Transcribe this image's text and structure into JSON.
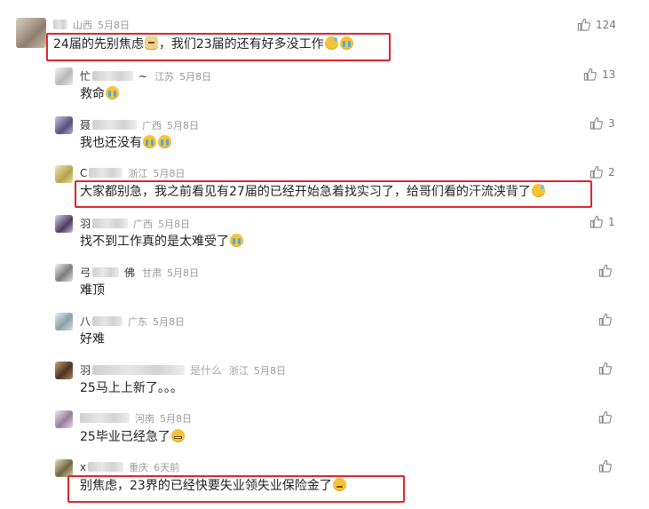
{
  "comments": [
    {
      "lead": "",
      "loc": "山西",
      "date": "5月8日",
      "text_before": "24届的先别焦虑",
      "text_mid": "，我们23届的还有好多没工作",
      "likes": "124"
    },
    {
      "lead": "忙",
      "lead2": "~",
      "loc": "江苏",
      "date": "5月8日",
      "text_before": "救命",
      "text_mid": "",
      "likes": "13"
    },
    {
      "lead": "聂",
      "loc": "广西",
      "date": "5月8日",
      "text_before": "我也还没有",
      "text_mid": "",
      "likes": "3"
    },
    {
      "lead": "C",
      "loc": "浙江",
      "date": "5月8日",
      "text_before": "大家都别急，我之前看见有27届的已经开始急着找实习了，给哥们看的汗流浃背了",
      "text_mid": "",
      "likes": "2"
    },
    {
      "lead": "羽",
      "loc": "广西",
      "date": "5月8日",
      "text_before": "找不到工作真的是太难受了",
      "text_mid": "",
      "likes": "1"
    },
    {
      "lead": "弓",
      "lead2": "佛",
      "loc": "甘肃",
      "date": "5月8日",
      "text_before": "难顶",
      "text_mid": "",
      "likes": ""
    },
    {
      "lead": "八",
      "loc": "广东",
      "date": "5月8日",
      "text_before": "好难",
      "text_mid": "",
      "likes": ""
    },
    {
      "lead": "羽",
      "lead2": "是什么",
      "loc": "浙江",
      "date": "5月8日",
      "text_before": "25马上上新了。。。",
      "text_mid": "",
      "likes": ""
    },
    {
      "lead": "",
      "loc": "河南",
      "date": "5月8日",
      "text_before": "25毕业已经急了",
      "text_mid": "",
      "likes": ""
    },
    {
      "lead": "x",
      "loc": "重庆",
      "date": "6天前",
      "text_before": "别焦虑，23界的已经快要失业领失业保险金了",
      "text_mid": "",
      "likes": ""
    }
  ],
  "colors": {
    "highlight": "#e0242a",
    "meta": "#9a9a9a"
  }
}
